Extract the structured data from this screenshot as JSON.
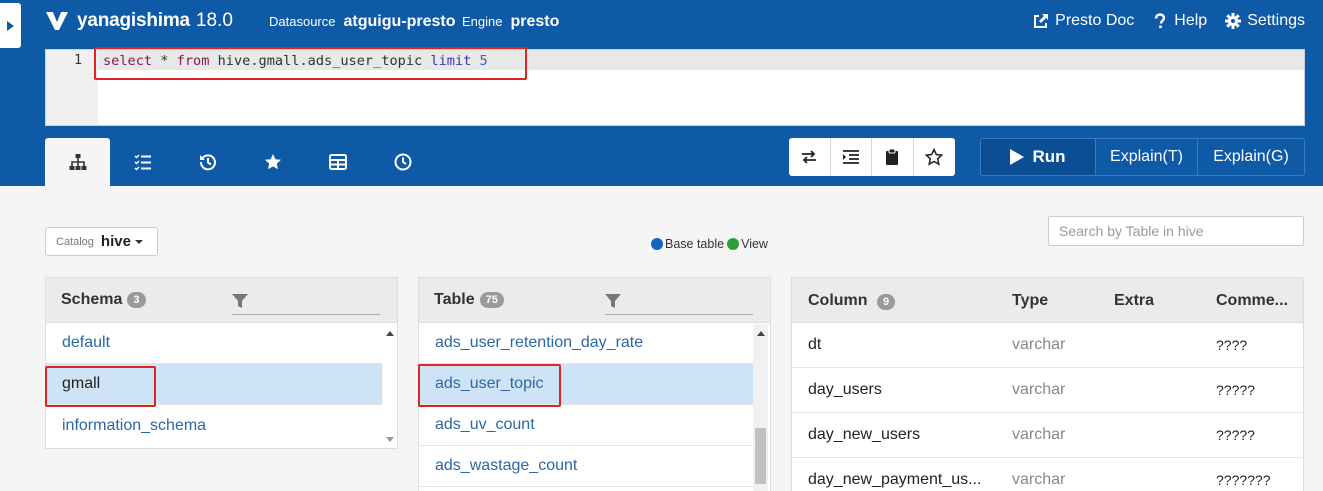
{
  "app": {
    "name": "yanagishima",
    "version": "18.0"
  },
  "header": {
    "datasource_label": "Datasource",
    "datasource_value": "atguigu-presto",
    "engine_label": "Engine",
    "engine_value": "presto",
    "links": {
      "doc": "Presto Doc",
      "help": "Help",
      "settings": "Settings"
    }
  },
  "editor": {
    "line_number": "1",
    "query": "select * from hive.gmall.ads_user_topic limit 5"
  },
  "tabs": {
    "icons": [
      "sitemap-icon",
      "tasklist-icon",
      "history-icon",
      "star-icon",
      "table-icon",
      "clock-icon"
    ],
    "active": 0
  },
  "toolbar": {
    "icons": [
      "swap-icon",
      "indent-icon",
      "clipboard-icon",
      "star-outline-icon"
    ]
  },
  "actions": {
    "run": "Run",
    "explain_t": "Explain(T)",
    "explain_g": "Explain(G)"
  },
  "catalog": {
    "label": "Catalog",
    "value": "hive"
  },
  "legend": {
    "base": "Base table",
    "view": "View",
    "base_color": "#1565c0",
    "view_color": "#2e9d3a"
  },
  "search": {
    "placeholder": "Search by Table in hive"
  },
  "schema": {
    "title": "Schema",
    "count": "3",
    "items": [
      "default",
      "gmall",
      "information_schema"
    ],
    "selected": "gmall"
  },
  "table": {
    "title": "Table",
    "count": "75",
    "items": [
      "ads_user_retention_day_rate",
      "ads_user_topic",
      "ads_uv_count",
      "ads_wastage_count"
    ],
    "selected": "ads_user_topic"
  },
  "columns": {
    "headers": {
      "column": "Column",
      "count": "9",
      "type": "Type",
      "extra": "Extra",
      "comment": "Comme..."
    },
    "rows": [
      {
        "name": "dt",
        "type": "varchar",
        "comment": "????"
      },
      {
        "name": "day_users",
        "type": "varchar",
        "comment": "?????"
      },
      {
        "name": "day_new_users",
        "type": "varchar",
        "comment": "?????"
      },
      {
        "name": "day_new_payment_us...",
        "type": "varchar",
        "comment": "???????"
      }
    ]
  },
  "colors": {
    "header_bg": "#0f5aa6",
    "highlight": "#e02323",
    "selected_row": "#cfe3f7"
  }
}
